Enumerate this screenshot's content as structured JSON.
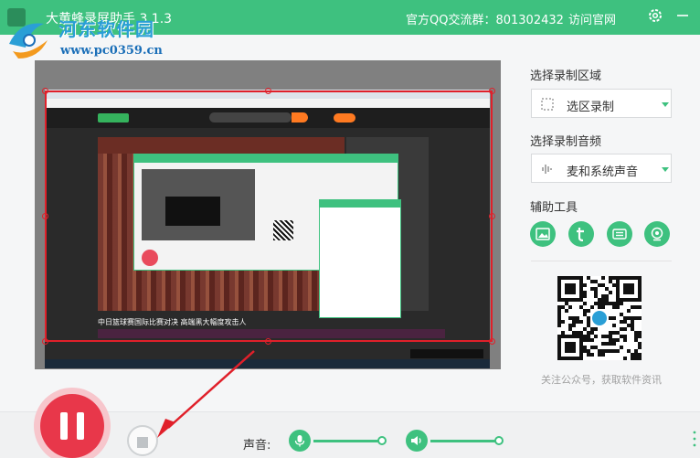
{
  "app": {
    "title": "大黄蜂录屏助手 3.1.3",
    "qq_group": "官方QQ交流群：801302432",
    "visit_site": "访问官网"
  },
  "watermark": {
    "title": "河东软件园",
    "url": "www.pc0359.cn"
  },
  "preview": {
    "news_caption": "中日篮球赛国际比赛对决 高端黑大幅度攻击人"
  },
  "panel": {
    "record_area_label": "选择录制区域",
    "record_area_value": "选区录制",
    "record_audio_label": "选择录制音频",
    "record_audio_value": "麦和系统声音",
    "tools_label": "辅助工具",
    "tools": [
      "image-tool-icon",
      "text-tool-icon",
      "keyboard-tool-icon",
      "camera-tool-icon"
    ],
    "qr_caption": "关注公众号，获取软件资讯"
  },
  "bottom": {
    "sound_label": "声音:",
    "mic_volume": 0.85,
    "speaker_volume": 0.85
  },
  "colors": {
    "accent": "#3ec17f",
    "record_red": "#e8374a",
    "selection_red": "#e0202a"
  }
}
